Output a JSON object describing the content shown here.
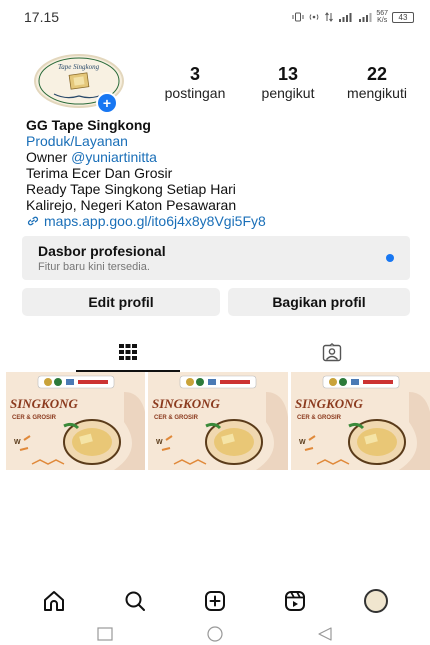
{
  "status_bar": {
    "time": "17.15",
    "icons": [
      "vibrate-icon",
      "hotspot-icon",
      "data-arrows-icon",
      "signal-4g-icon",
      "signal-icon",
      "speed-icon",
      "battery-icon"
    ],
    "speed": "567",
    "speed_unit": "K/s",
    "battery": "43"
  },
  "profile": {
    "avatar_text": "Tape Singkong",
    "stats": [
      {
        "value": "3",
        "label": "postingan"
      },
      {
        "value": "13",
        "label": "pengikut"
      },
      {
        "value": "22",
        "label": "mengikuti"
      }
    ],
    "name": "GG Tape Singkong",
    "category": "Produk/Layanan",
    "owner_prefix": "Owner ",
    "owner_mention": "@yuniartinitta",
    "bio_lines": [
      "Terima Ecer Dan Grosir",
      "Ready Tape Singkong Setiap Hari",
      "Kalirejo, Negeri Katon Pesawaran"
    ],
    "link": "maps.app.goo.gl/ito6j4x8y8Vgi5Fy8"
  },
  "dashboard": {
    "title": "Dasbor profesional",
    "subtitle": "Fitur baru kini tersedia."
  },
  "buttons": {
    "edit": "Edit profil",
    "share": "Bagikan profil"
  },
  "posts": [
    {
      "title": "SINGKONG",
      "subtitle": "CER & GROSIR"
    },
    {
      "title": "SINGKONG",
      "subtitle": "CER & GROSIR"
    },
    {
      "title": "SINGKONG",
      "subtitle": "CER & GROSIR"
    }
  ],
  "colors": {
    "accent": "#1877f2",
    "link": "#1a6fb8",
    "surface": "#efefef",
    "post_bg": "#f6e7d6",
    "post_title": "#8b3a1e"
  },
  "bottom_nav": [
    "home-icon",
    "search-icon",
    "create-icon",
    "reels-icon",
    "profile-avatar"
  ]
}
